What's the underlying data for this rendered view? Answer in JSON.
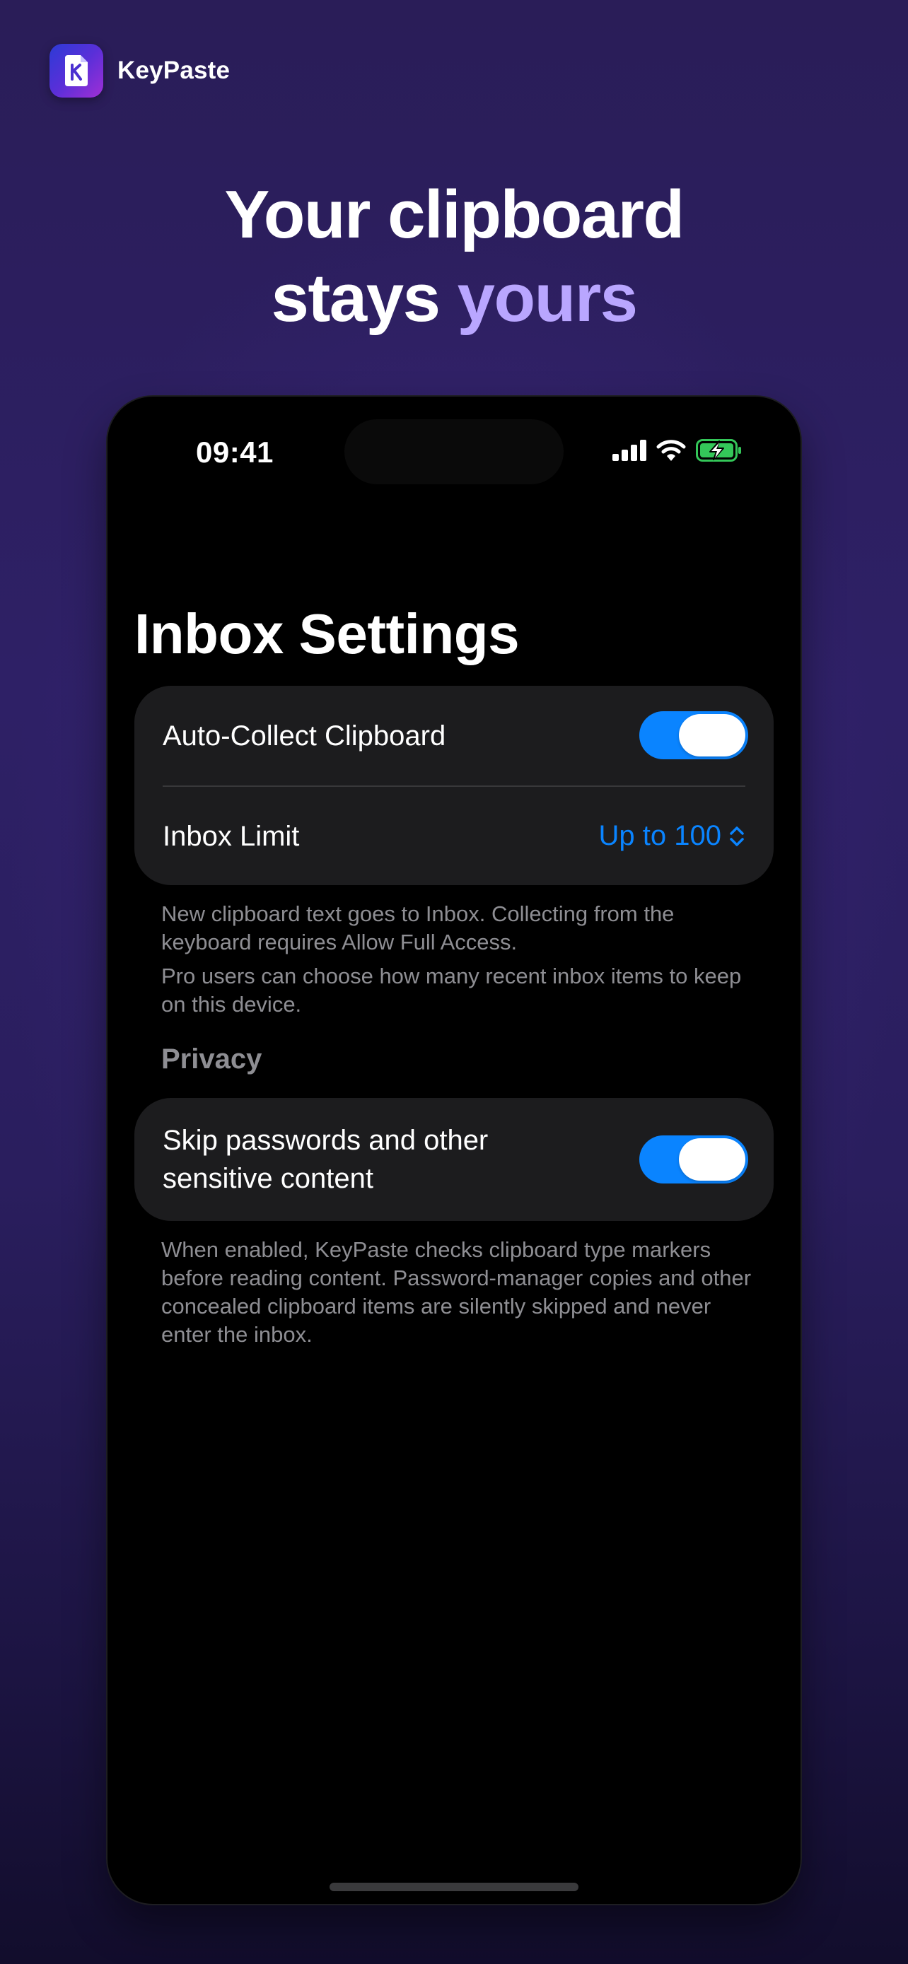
{
  "brand": {
    "app_name": "KeyPaste",
    "icon": "keypaste-app-icon"
  },
  "headline": {
    "line1": "Your clipboard",
    "line2_plain": "stays ",
    "line2_accent": "yours"
  },
  "status_bar": {
    "time": "09:41",
    "icons": [
      "signal-icon",
      "wifi-icon",
      "battery-charging-icon"
    ]
  },
  "screen": {
    "title": "Inbox Settings",
    "group1": {
      "auto_collect": {
        "label": "Auto-Collect Clipboard",
        "enabled": true
      },
      "inbox_limit": {
        "label": "Inbox Limit",
        "value": "Up to 100",
        "icon": "chevron-up-down-icon"
      },
      "footer": [
        "New clipboard text goes to Inbox. Collecting from the keyboard requires Allow Full Access.",
        "Pro users can choose how many recent inbox items to keep on this device."
      ]
    },
    "privacy": {
      "header": "Privacy",
      "skip_sensitive": {
        "label": "Skip passwords and other sensitive content",
        "enabled": true
      },
      "footer": "When enabled, KeyPaste checks clipboard type markers before reading content. Password-manager copies and other concealed clipboard items are silently skipped and never enter the inbox."
    }
  },
  "colors": {
    "accent_blue": "#0a84ff",
    "headline_accent": "#b9a6ff",
    "card_bg": "#1c1c1e",
    "footnote": "#8e8e93",
    "battery_green": "#34c759"
  }
}
